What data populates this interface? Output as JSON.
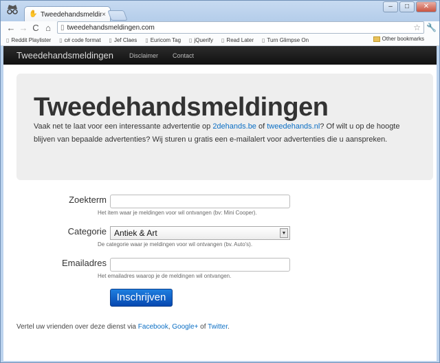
{
  "browser": {
    "tab_title": "Tweedehandsmeldingen",
    "tab_close": "×",
    "url": "tweedehandsmeldingen.com",
    "window_controls": [
      "–",
      "□",
      "✕"
    ],
    "bookmarks": [
      {
        "label": "Reddit Playlister",
        "icon": "page-icon"
      },
      {
        "label": "c# code format",
        "icon": "page-icon"
      },
      {
        "label": "Jef Claes",
        "icon": "page-icon"
      },
      {
        "label": "Euricom Tag",
        "icon": "page-icon"
      },
      {
        "label": "jQuerify",
        "icon": "page-icon"
      },
      {
        "label": "Read Later",
        "icon": "page-icon"
      },
      {
        "label": "Turn Glimpse On",
        "icon": "page-icon"
      }
    ],
    "other_bookmarks": "Other bookmarks"
  },
  "navbar": {
    "brand": "Tweedehandsmeldingen",
    "links": [
      "Disclaimer",
      "Contact"
    ]
  },
  "hero": {
    "title": "Tweedehandsmeldingen",
    "text_1": "Vaak net te laat voor een interessante advertentie op ",
    "link_1": "2dehands.be",
    "text_2": " of ",
    "link_2": "tweedehands.nl",
    "text_3": "? Of wilt u op de hoogte blijven van bepaalde advertenties? Wij sturen u gratis een e-mailalert voor advertenties die u aanspreken."
  },
  "form": {
    "search_term": {
      "label": "Zoekterm",
      "value": "",
      "help": "Het item waar je meldingen voor wil ontvangen (bv: Mini Cooper)."
    },
    "category": {
      "label": "Categorie",
      "selected": "Antiek & Art",
      "help": "De categorie waar je meldingen voor wil ontvangen (bv. Auto's)."
    },
    "email": {
      "label": "Emailadres",
      "value": "",
      "help": "Het emailadres waarop je de meldingen wil ontvangen."
    },
    "submit_label": "Inschrijven"
  },
  "footer": {
    "text_1": "Vertel uw vrienden over deze dienst via ",
    "facebook": "Facebook",
    "sep": ", ",
    "googleplus": "Google+",
    "text_2": " of ",
    "twitter": "Twitter",
    "text_3": "."
  },
  "colors": {
    "link": "#0a6ec4",
    "navbar": "#1b1b1b",
    "hero_bg": "#eeeeee",
    "button": "#0b5cc9"
  }
}
